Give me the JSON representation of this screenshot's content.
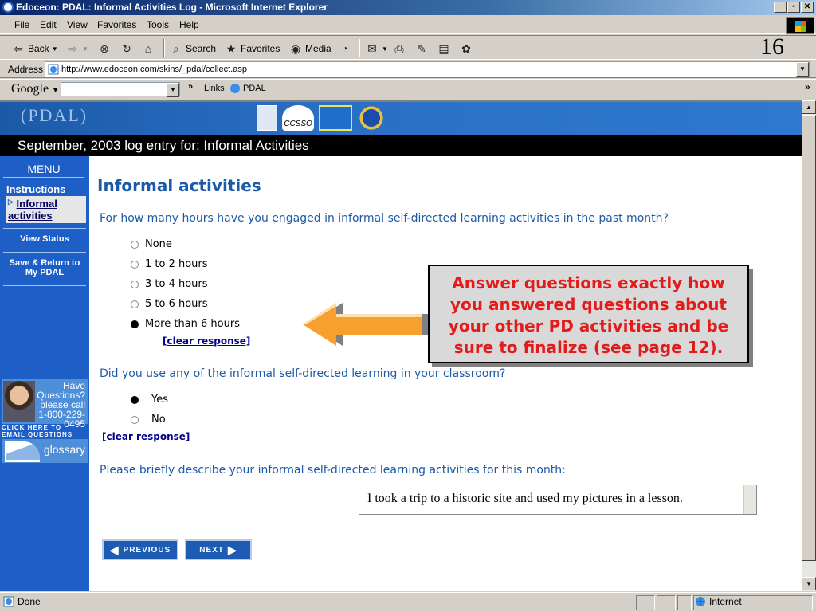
{
  "window": {
    "title": "Edoceon: PDAL: Informal Activities Log - Microsoft Internet Explorer",
    "buttons": [
      "_",
      "▫",
      "✕"
    ]
  },
  "menu": [
    "File",
    "Edit",
    "View",
    "Favorites",
    "Tools",
    "Help"
  ],
  "toolbar": {
    "back": "Back",
    "search": "Search",
    "favorites": "Favorites",
    "media": "Media"
  },
  "slide_number": "16",
  "address": {
    "label": "Address",
    "url": "http://www.edoceon.com/skins/_pdal/collect.asp"
  },
  "google_bar": {
    "logo": "Google",
    "links_label": "Links",
    "pdal_link": "PDAL"
  },
  "banner": {
    "pdal_text": "(PDAL)",
    "logos": [
      "NAS",
      "CCSSO",
      "WCER",
      "NSF"
    ],
    "ccsso_label": "CCSSO",
    "entry_title": "September, 2003 log entry for: Informal Activities"
  },
  "sidebar": {
    "menu_title": "MENU",
    "instructions": "Instructions",
    "current": "Informal activities",
    "view_status": "View Status",
    "save_return": "Save & Return to My PDAL",
    "help_text": "Have Questions? please call 1-800-229-0495",
    "email_text": "CLICK HERE TO EMAIL QUESTIONS",
    "glossary": "glossary"
  },
  "main": {
    "heading": "Informal activities",
    "q1": "For how many hours have you engaged in informal self-directed learning activities in the past month?",
    "q1_options": [
      {
        "label": "None",
        "selected": false
      },
      {
        "label": "1 to 2 hours",
        "selected": false
      },
      {
        "label": "3 to 4 hours",
        "selected": false
      },
      {
        "label": "5 to 6 hours",
        "selected": false
      },
      {
        "label": "More than 6 hours",
        "selected": true
      }
    ],
    "clear_response": "[clear response]",
    "q2": "Did you use any of the informal self-directed learning in your classroom?",
    "q2_options": [
      {
        "label": "Yes",
        "selected": true
      },
      {
        "label": "No",
        "selected": false
      }
    ],
    "q3": "Please briefly describe your informal self-directed learning activities for this month:",
    "q3_answer": "I took a trip to a historic site and used my pictures in a lesson.",
    "previous": "PREVIOUS",
    "next": "NEXT"
  },
  "callout": {
    "text": "Answer questions exactly how you answered questions about your other PD activities and be sure to finalize (see page 12).",
    "color": "#e41b1b",
    "arrow_color": "#f7a030"
  },
  "status": {
    "left": "Done",
    "zone": "Internet"
  }
}
